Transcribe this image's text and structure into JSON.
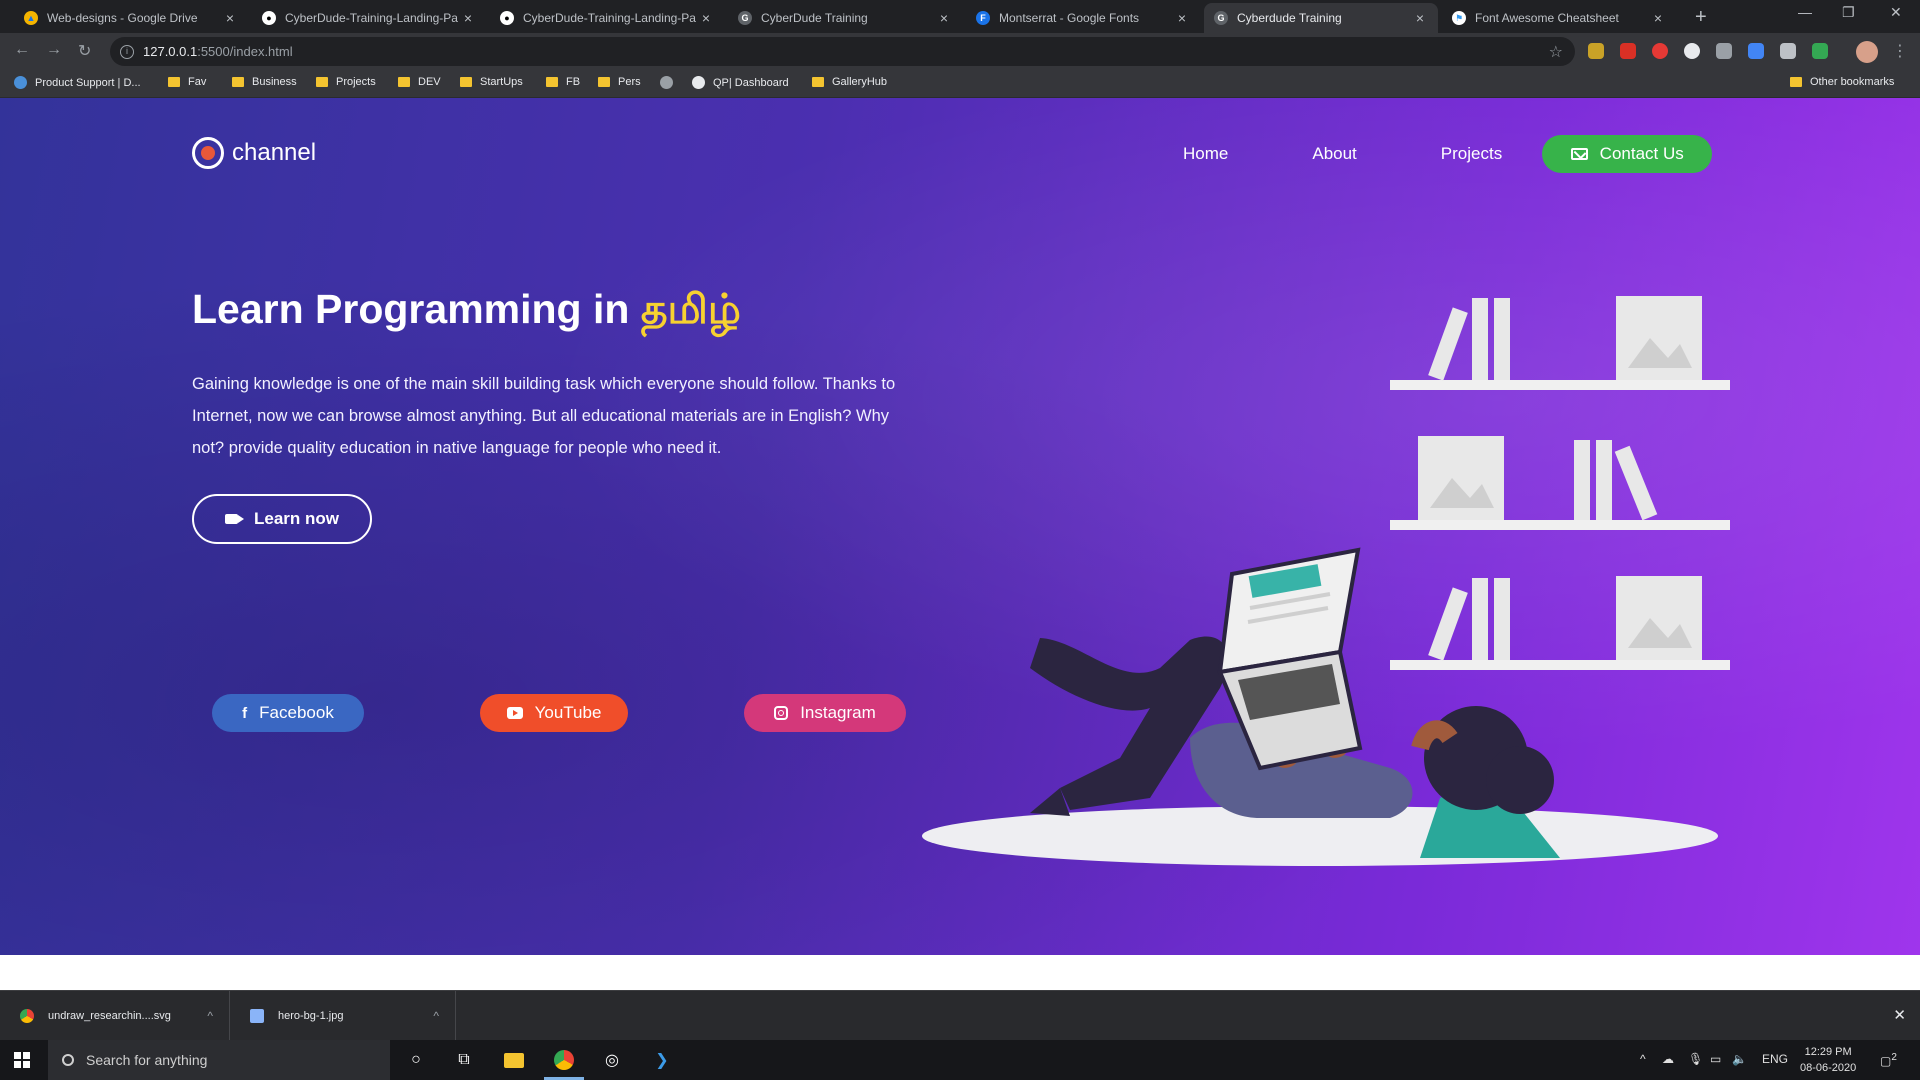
{
  "browser": {
    "tabs": [
      {
        "title": "Web-designs - Google Drive",
        "favicon": "google-drive-icon",
        "active": false
      },
      {
        "title": "CyberDude-Training-Landing-Pa",
        "favicon": "github-icon",
        "active": false
      },
      {
        "title": "CyberDude-Training-Landing-Pa",
        "favicon": "github-icon",
        "active": false
      },
      {
        "title": "CyberDude Training",
        "favicon": "cyberdude-icon",
        "active": false
      },
      {
        "title": "Montserrat - Google Fonts",
        "favicon": "google-fonts-icon",
        "active": false
      },
      {
        "title": "Cyberdude Training",
        "favicon": "cyberdude-icon",
        "active": true
      },
      {
        "title": "Font Awesome Cheatsheet",
        "favicon": "font-awesome-icon",
        "active": false
      }
    ],
    "url_host": "127.0.0.1",
    "url_path": ":5500/index.html",
    "bookmarks": [
      {
        "label": "Product Support | D...",
        "icon": "globe-icon"
      },
      {
        "label": "Fav",
        "icon": "folder-icon"
      },
      {
        "label": "Business",
        "icon": "folder-icon"
      },
      {
        "label": "Projects",
        "icon": "folder-icon"
      },
      {
        "label": "DEV",
        "icon": "folder-icon"
      },
      {
        "label": "StartUps",
        "icon": "folder-icon"
      },
      {
        "label": "FB",
        "icon": "folder-icon"
      },
      {
        "label": "Pers",
        "icon": "folder-icon"
      },
      {
        "label": "",
        "icon": "globe-icon"
      },
      {
        "label": "QP| Dashboard",
        "icon": "globe-icon"
      },
      {
        "label": "GalleryHub",
        "icon": "folder-icon"
      }
    ],
    "other_bookmarks": "Other bookmarks"
  },
  "site": {
    "logo_text": "channel",
    "nav": [
      "Home",
      "About",
      "Projects"
    ],
    "contact_label": "Contact Us",
    "hero_title_prefix": "Learn Programming in ",
    "hero_title_highlight": "தமிழ்",
    "hero_description": "Gaining knowledge is one of the main skill building task which everyone should follow. Thanks to Internet, now we can browse almost anything. But all educational materials are in English? Why not? provide quality education in native language for people who need it.",
    "learn_label": "Learn now",
    "social": {
      "facebook": "Facebook",
      "youtube": "YouTube",
      "instagram": "Instagram"
    },
    "colors": {
      "accent_green": "#37b34a",
      "highlight_yellow": "#f7d130",
      "facebook": "#3a67c2",
      "youtube": "#f04e2a",
      "instagram": "#d4387a"
    }
  },
  "downloads": [
    {
      "name": "undraw_researchin....svg",
      "icon": "chrome-icon"
    },
    {
      "name": "hero-bg-1.jpg",
      "icon": "file-icon"
    }
  ],
  "taskbar": {
    "search_placeholder": "Search for anything",
    "language": "ENG",
    "time": "12:29 PM",
    "date": "08-06-2020",
    "notification_count": "2"
  }
}
